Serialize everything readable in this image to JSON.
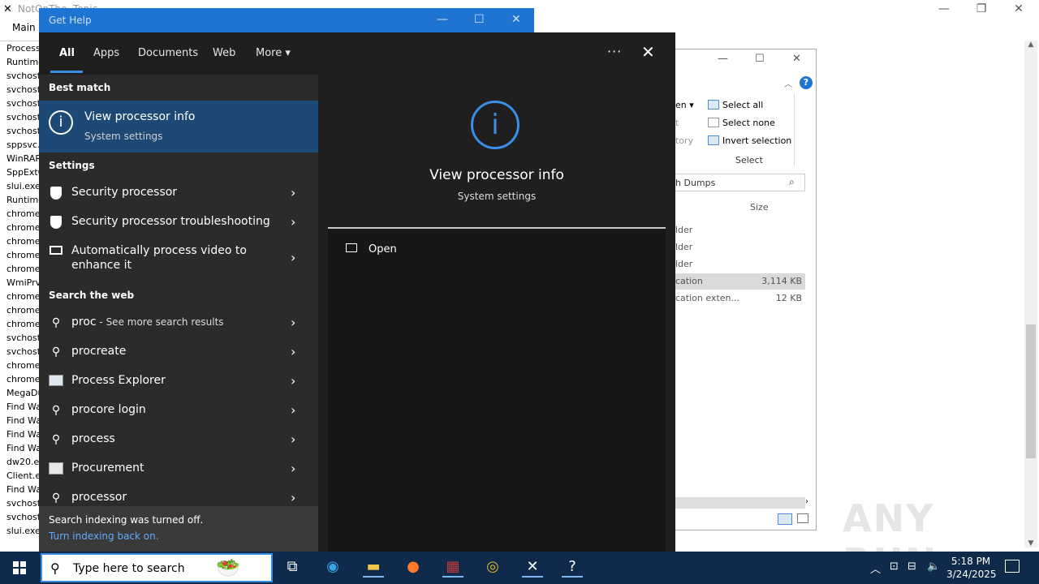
{
  "background_app": {
    "title": "NotOnThe..Tonic",
    "menu": "Main",
    "processes": [
      "Process",
      "Runtime",
      "svchost.",
      "svchost.",
      "svchost.",
      "svchost.",
      "svchost.",
      "sppsvc.",
      "WinRAR",
      "SppExtC",
      "slui.exe",
      "Runtime",
      "chrome.",
      "chrome.",
      "chrome.",
      "chrome.",
      "chrome.",
      "WmiPrvS",
      "chrome.",
      "chrome.",
      "chrome.",
      "svchost.",
      "svchost.",
      "chrome.",
      "chrome.",
      "MegaDu",
      "Find Wa",
      "Find Wa",
      "Find Wa",
      "Find Wa",
      "dw20.ex",
      "Client.ex",
      "Find Wa",
      "svchost.",
      "svchost.",
      "slui.exe"
    ]
  },
  "explorer": {
    "select_all": "Select all",
    "select_none": "Select none",
    "invert_selection": "Invert selection",
    "select_group": "Select",
    "partial_open": "en",
    "partial_history": "t",
    "partial_category": "tory",
    "search_placeholder": "h Dumps",
    "size_header": "Size",
    "files": [
      {
        "type": "lder",
        "size": ""
      },
      {
        "type": "lder",
        "size": ""
      },
      {
        "type": "lder",
        "size": ""
      },
      {
        "type": "cation",
        "size": "3,114 KB"
      },
      {
        "type": "cation exten...",
        "size": "12 KB"
      }
    ]
  },
  "get_help": {
    "title": "Get Help"
  },
  "search_panel": {
    "tabs": [
      "All",
      "Apps",
      "Documents",
      "Web",
      "More"
    ],
    "best_match_header": "Best match",
    "best_match": {
      "title": "View processor info",
      "subtitle": "System settings"
    },
    "settings_header": "Settings",
    "settings": [
      "Security processor",
      "Security processor troubleshooting",
      "Automatically process video to",
      "enhance it"
    ],
    "web_header": "Search the web",
    "web_query": "proc",
    "web_query_suffix": " - See more search results",
    "web_results": [
      "procreate",
      "Process Explorer",
      "procore login",
      "process",
      "Procurement",
      "processor"
    ],
    "index_off": "Search indexing was turned off.",
    "index_on_link": "Turn indexing back on.",
    "preview": {
      "title": "View processor info",
      "subtitle": "System settings",
      "open": "Open"
    }
  },
  "watermark": "ANY RUN",
  "taskbar": {
    "search_placeholder": "Type here to search",
    "time": "5:18 PM",
    "date": "3/24/2025"
  }
}
